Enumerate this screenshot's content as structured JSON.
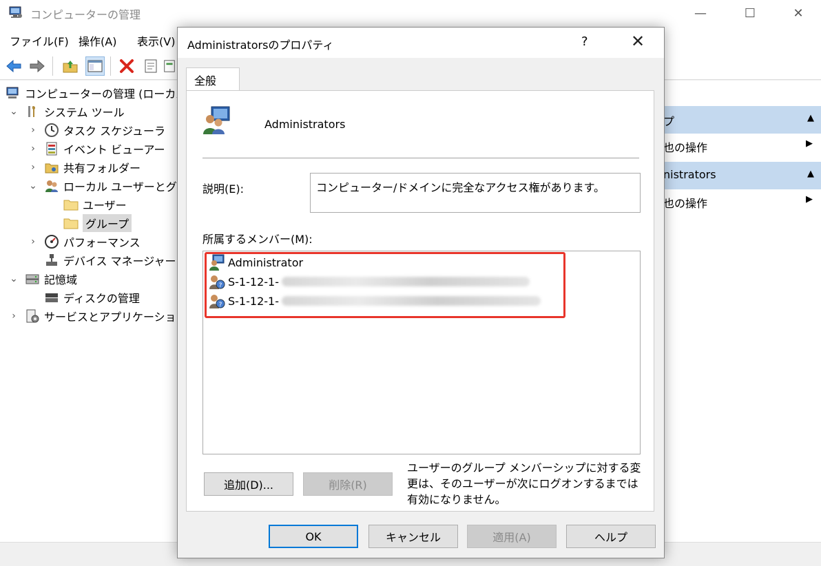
{
  "window": {
    "title": "コンピューターの管理",
    "minimize": "—",
    "maximize": "☐",
    "close": "✕"
  },
  "menubar": {
    "file": "ファイル(F)",
    "action": "操作(A)",
    "view": "表示(V)"
  },
  "toolbar": {
    "icons": [
      "back-arrow-icon",
      "forward-arrow-icon",
      "up-folder-icon",
      "show-hide-tree-icon",
      "delete-icon",
      "properties-icon",
      "export-list-icon"
    ]
  },
  "tree": {
    "root": "コンピューターの管理 (ローカル)",
    "system_tools": "システム ツール",
    "task_scheduler": "タスク スケジューラ",
    "event_viewer": "イベント ビューアー",
    "shared_folders": "共有フォルダー",
    "local_users_groups": "ローカル ユーザーとグル",
    "users": "ユーザー",
    "groups": "グループ",
    "performance": "パフォーマンス",
    "device_manager": "デバイス マネージャー",
    "storage": "記憶域",
    "disk_management": "ディスクの管理",
    "services_apps": "サービスとアプリケーション",
    "expand_glyph": "›",
    "collapse_glyph": "⌄"
  },
  "actions": {
    "head1": "プ",
    "item1": "也の操作",
    "head2": "nistrators",
    "item2": "也の操作",
    "up_arrow": "▲",
    "right_arrow": "▶"
  },
  "dialog": {
    "title": "Administratorsのプロパティ",
    "help": "?",
    "close": "✕",
    "tab": "全般",
    "group_name": "Administrators",
    "description_label": "説明(E):",
    "description_value": "コンピューター/ドメインに完全なアクセス権があります。",
    "members_label": "所属するメンバー(M):",
    "members": [
      {
        "name": "Administrator"
      },
      {
        "name": "S-1-12-1-"
      },
      {
        "name": "S-1-12-1-"
      }
    ],
    "add_button": "追加(D)...",
    "remove_button": "削除(R)",
    "note": "ユーザーのグループ メンバーシップに対する変更は、そのユーザーが次にログオンするまでは有効になりません。",
    "ok_button": "OK",
    "cancel_button": "キャンセル",
    "apply_button": "適用(A)",
    "help_button": "ヘルプ"
  },
  "colors": {
    "highlight_border": "#e8352b",
    "action_header": "#c4d9ef",
    "default_button": "#0078d7"
  }
}
